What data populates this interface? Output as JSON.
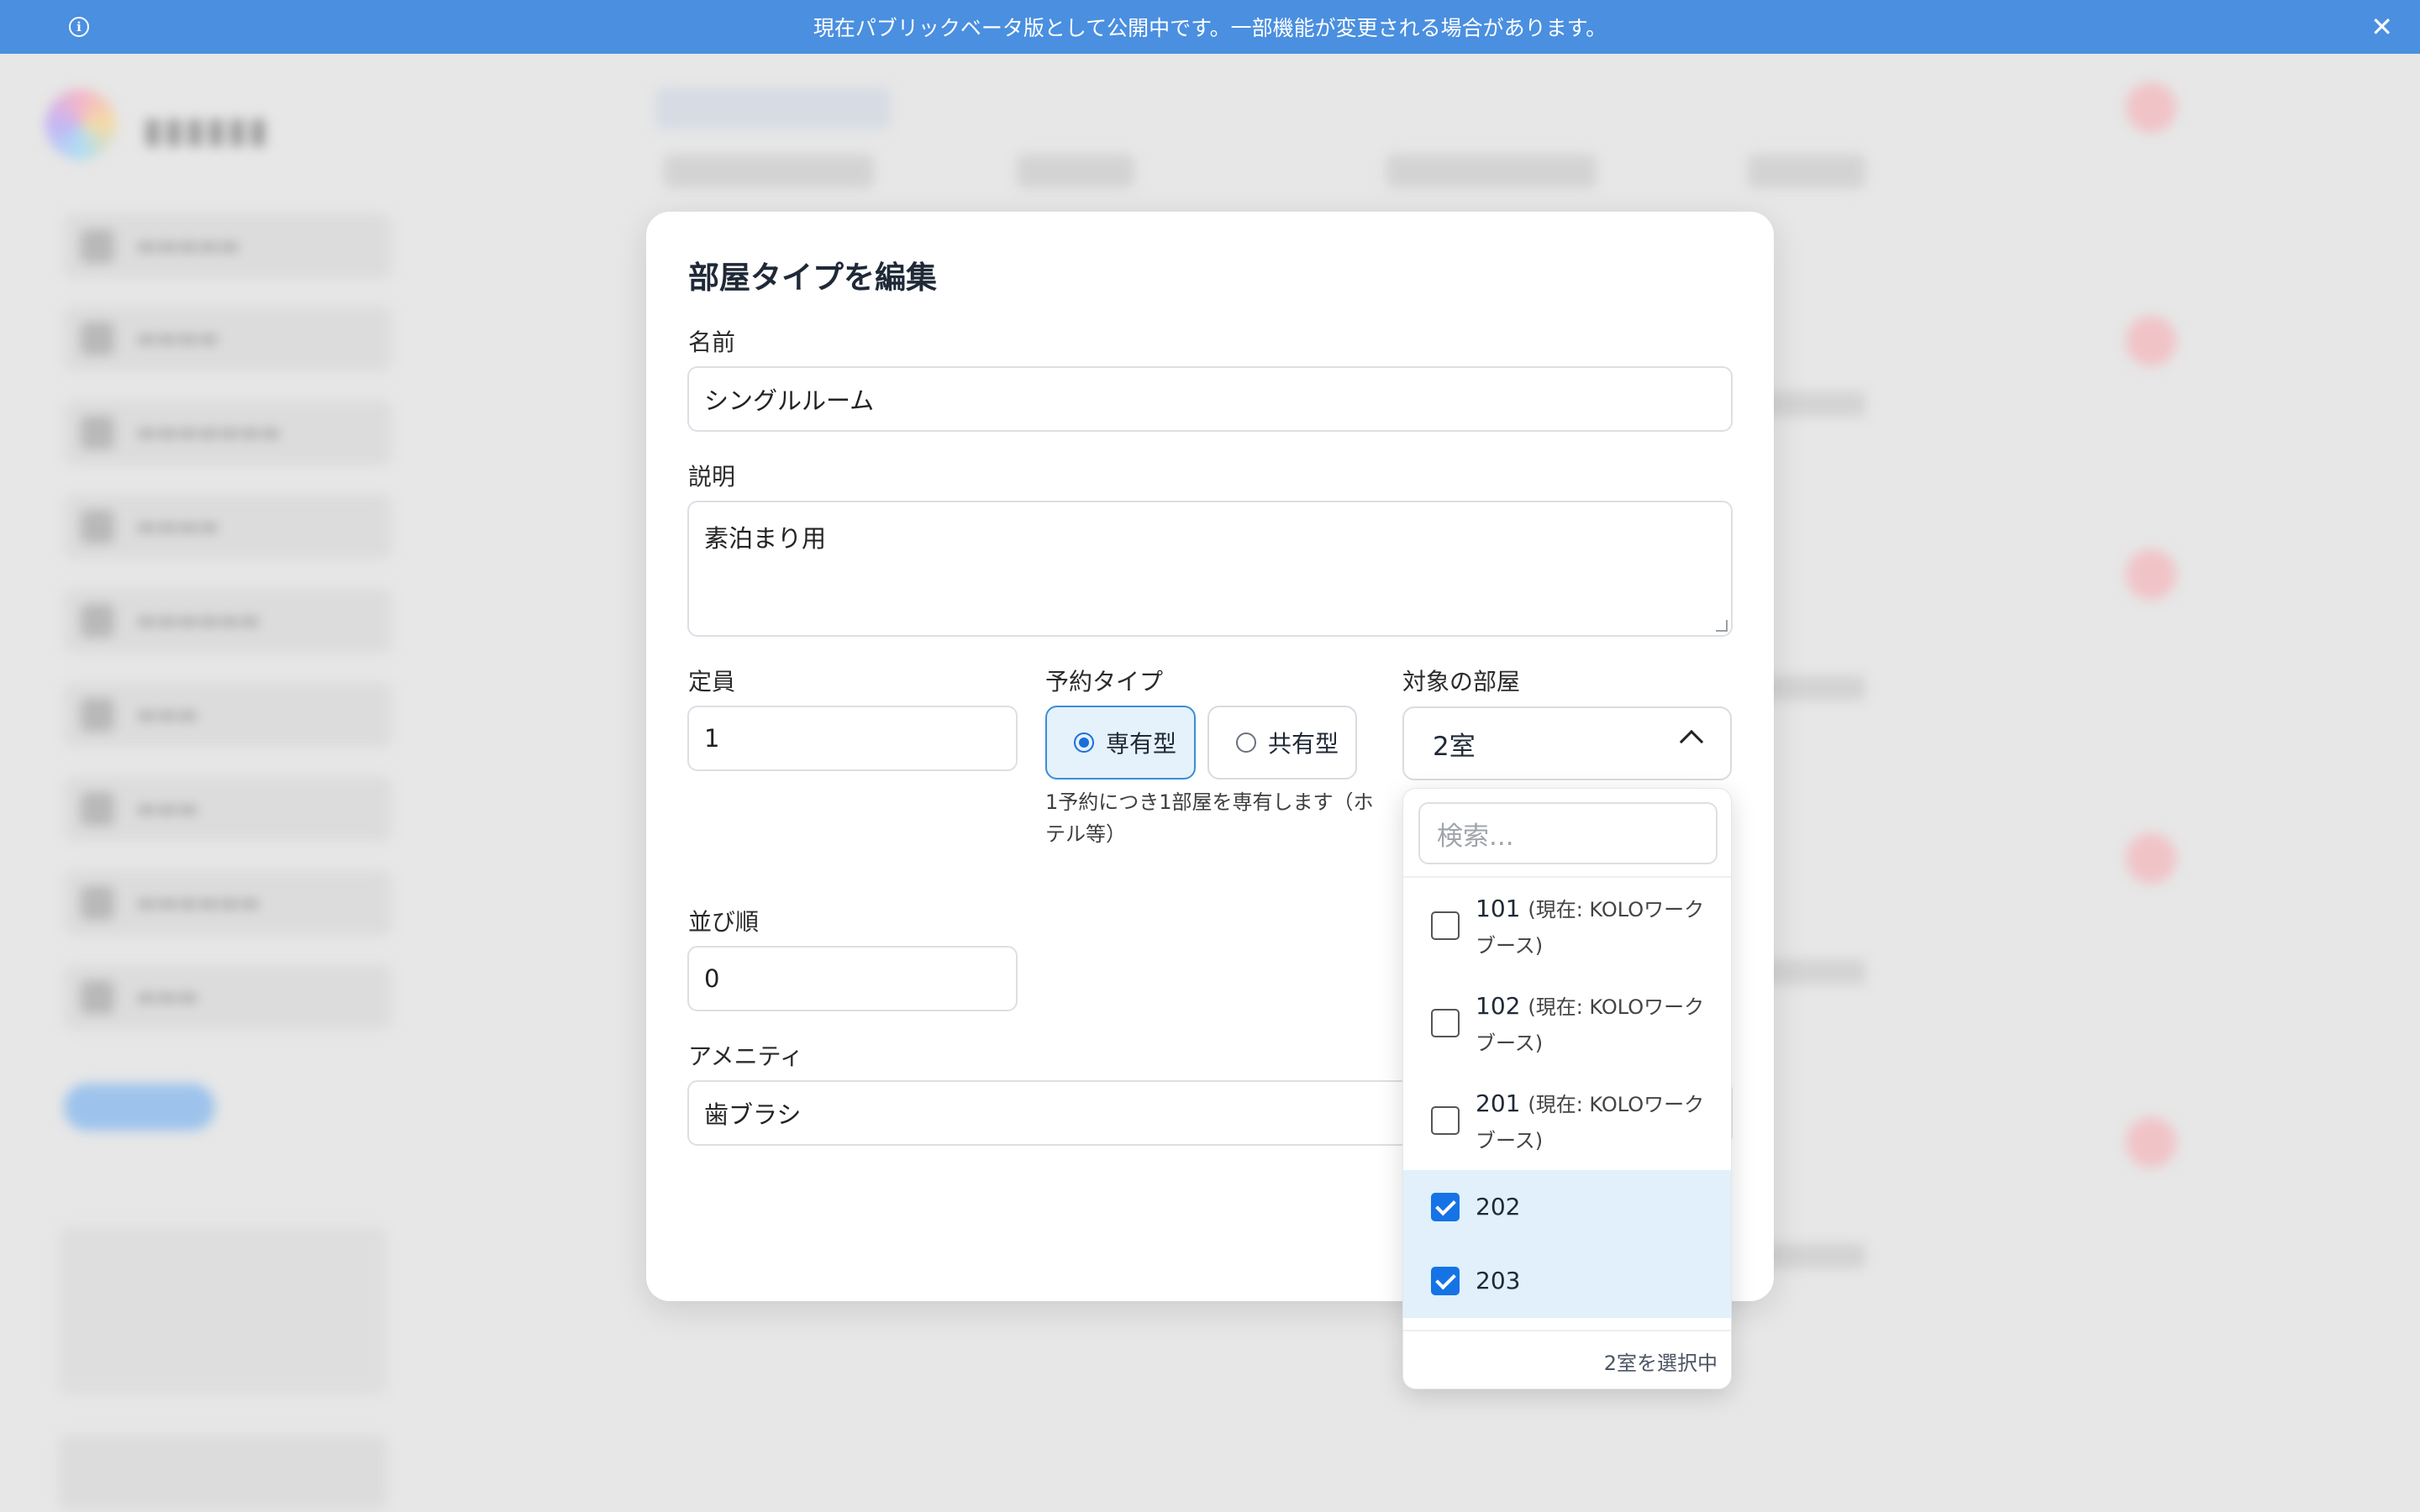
{
  "banner": {
    "message": "現在パブリックベータ版として公開中です。一部機能が変更される場合があります。",
    "info_icon": "info-icon",
    "close_icon": "close-icon"
  },
  "modal": {
    "title": "部屋タイプを編集",
    "name": {
      "label": "名前",
      "value": "シングルルーム"
    },
    "description": {
      "label": "説明",
      "value": "素泊まり用"
    },
    "capacity": {
      "label": "定員",
      "value": "1"
    },
    "booking_type": {
      "label": "予約タイプ",
      "options": [
        {
          "label": "専有型",
          "selected": true
        },
        {
          "label": "共有型",
          "selected": false
        }
      ],
      "help": "1予約につき1部屋を専有します（ホテル等）"
    },
    "sort_order": {
      "label": "並び順",
      "value": "0"
    },
    "amenities": {
      "label": "アメニティ",
      "value": "歯ブラシ"
    },
    "target_rooms": {
      "label": "対象の部屋",
      "selected_summary": "2室",
      "search_placeholder": "検索...",
      "options": [
        {
          "number": "101",
          "note": "(現在: KOLOワークブース)",
          "checked": false
        },
        {
          "number": "102",
          "note": "(現在: KOLOワークブース)",
          "checked": false
        },
        {
          "number": "201",
          "note": "(現在: KOLOワークブース)",
          "checked": false
        },
        {
          "number": "202",
          "note": "",
          "checked": true
        },
        {
          "number": "203",
          "note": "",
          "checked": true
        }
      ],
      "footer": "2室を選択中"
    }
  },
  "colors": {
    "banner": "#4a8fe0",
    "accent": "#1573e6",
    "selected_row": "#e1f0fb"
  }
}
